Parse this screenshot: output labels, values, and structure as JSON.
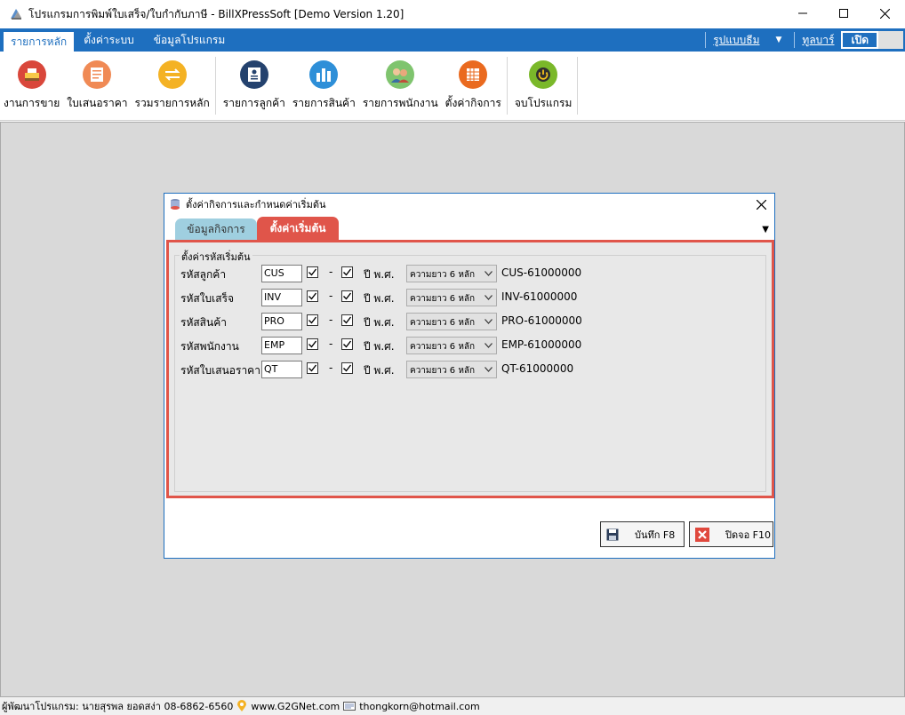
{
  "window": {
    "title": "โปรแกรมการพิมพ์ใบเสร็จ/ใบกำกับภาษี - BillXPressSoft [Demo Version 1.20]"
  },
  "menu": {
    "tabs": [
      {
        "label": "รายการหลัก",
        "active": true
      },
      {
        "label": "ตั้งค่าระบบ",
        "active": false
      },
      {
        "label": "ข้อมูลโปรแกรม",
        "active": false
      }
    ],
    "theme_label": "รูปแบบธีม",
    "toolbar_label": "ทูลบาร์",
    "toggle_on_label": "เปิด"
  },
  "ribbon": {
    "groups": [
      [
        {
          "label": "งานการขาย",
          "icon": "cash-register-icon",
          "color": "#d9473b"
        },
        {
          "label": "ใบเสนอราคา",
          "icon": "document-icon",
          "color": "#f08a55"
        },
        {
          "label": "รวมรายการหลัก",
          "icon": "transfer-icon",
          "color": "#f4b224"
        }
      ],
      [
        {
          "label": "รายการลูกค้า",
          "icon": "contact-card-icon",
          "color": "#24426e"
        },
        {
          "label": "รายการสินค้า",
          "icon": "buildings-icon",
          "color": "#2e8fd8"
        },
        {
          "label": "รายการพนักงาน",
          "icon": "people-icon",
          "color": "#7fc46e"
        },
        {
          "label": "ตั้งค่ากิจการ",
          "icon": "calendar-grid-icon",
          "color": "#ea6a1f"
        }
      ],
      [
        {
          "label": "จบโปรแกรม",
          "icon": "power-icon",
          "color": "#7ab82a"
        }
      ]
    ]
  },
  "dialog": {
    "title": "ตั้งค่ากิจการและกำหนดค่าเริ่มต้น",
    "tabs": [
      "ข้อมูลกิจการ",
      "ตั้งค่าเริ่มต้น"
    ],
    "group_title": "ตั้งค่ารหัสเริ่มต้น",
    "rows": [
      {
        "label": "รหัสลูกค้า",
        "prefix": "CUS",
        "dash": "-",
        "year_label": "ปี พ.ศ.",
        "length": "ความยาว 6 หลัก",
        "example": "CUS-61000000"
      },
      {
        "label": "รหัสใบเสร็จ",
        "prefix": "INV",
        "dash": "-",
        "year_label": "ปี พ.ศ.",
        "length": "ความยาว 6 หลัก",
        "example": "INV-61000000"
      },
      {
        "label": "รหัสสินค้า",
        "prefix": "PRO",
        "dash": "-",
        "year_label": "ปี พ.ศ.",
        "length": "ความยาว 6 หลัก",
        "example": "PRO-61000000"
      },
      {
        "label": "รหัสพนักงาน",
        "prefix": "EMP",
        "dash": "-",
        "year_label": "ปี พ.ศ.",
        "length": "ความยาว 6 หลัก",
        "example": "EMP-61000000"
      },
      {
        "label": "รหัสใบเสนอราคา",
        "prefix": "QT",
        "dash": "-",
        "year_label": "ปี พ.ศ.",
        "length": "ความยาว 6 หลัก",
        "example": "QT-61000000"
      }
    ],
    "save_label": "บันทึก F8",
    "close_label": "ปิดจอ F10"
  },
  "status": {
    "developer": "ผู้พัฒนาโปรแกรม: นายสุรพล ยอดสง่า 08-6862-6560",
    "website": "www.G2GNet.com",
    "email": "thongkorn@hotmail.com"
  }
}
